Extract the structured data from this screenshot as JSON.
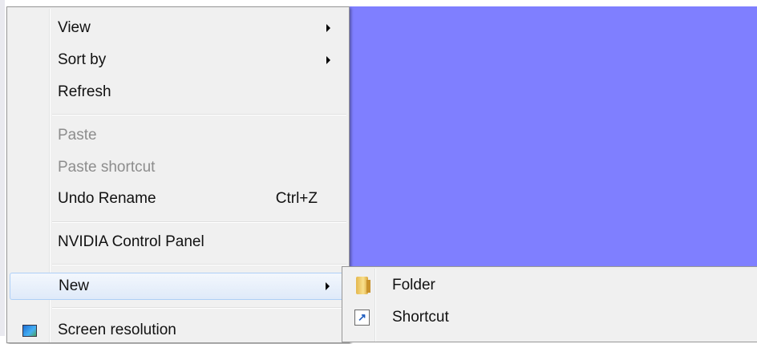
{
  "context_menu": {
    "items": [
      {
        "label": "View",
        "submenu": true
      },
      {
        "label": "Sort by",
        "submenu": true
      },
      {
        "label": "Refresh"
      },
      {
        "label": "Paste",
        "disabled": true
      },
      {
        "label": "Paste shortcut",
        "disabled": true
      },
      {
        "label": "Undo Rename",
        "shortcut": "Ctrl+Z"
      },
      {
        "label": "NVIDIA Control Panel"
      },
      {
        "label": "New",
        "submenu": true,
        "highlighted": true
      },
      {
        "label": "Screen resolution",
        "icon": "screen-resolution-icon"
      }
    ]
  },
  "new_submenu": {
    "items": [
      {
        "label": "Folder",
        "icon": "folder-icon"
      },
      {
        "label": "Shortcut",
        "icon": "shortcut-icon"
      }
    ]
  },
  "colors": {
    "desktop": "#7f7fff",
    "menu_background": "#f0f0f0",
    "highlight": "#dfeaf9"
  }
}
